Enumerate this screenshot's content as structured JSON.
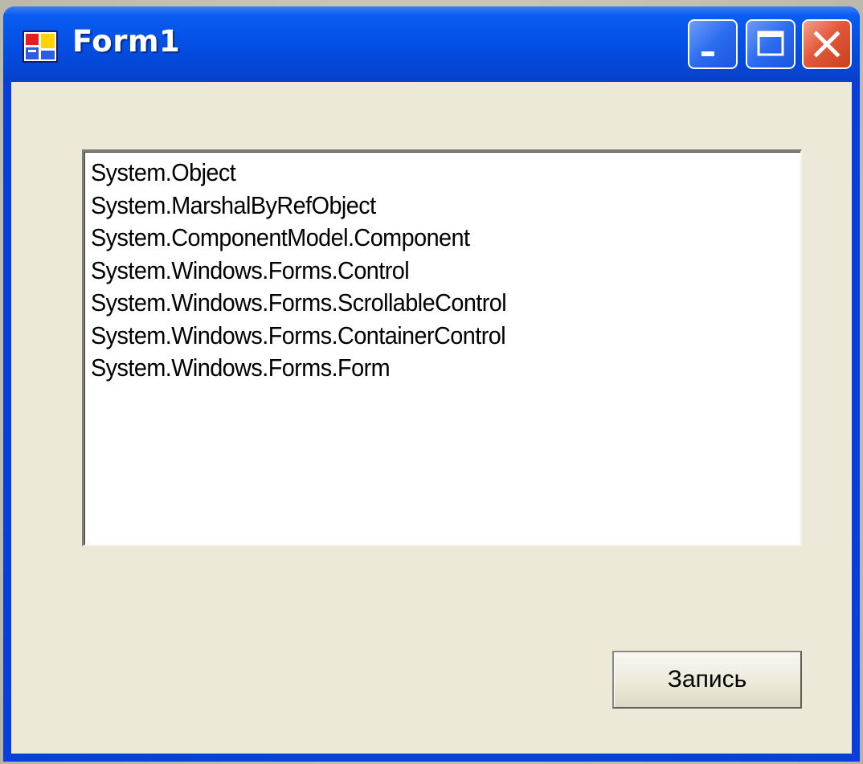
{
  "window": {
    "title": "Form1",
    "controls": {
      "minimize_icon": "minimize-icon",
      "maximize_icon": "maximize-icon",
      "close_icon": "close-icon"
    },
    "colors": {
      "titlebar": "#0551e6",
      "client": "#ece9d8",
      "close_button": "#e3583a"
    }
  },
  "listbox": {
    "items": [
      "System.Object",
      "System.MarshalByRefObject",
      "System.ComponentModel.Component",
      "System.Windows.Forms.Control",
      "System.Windows.Forms.ScrollableControl",
      "System.Windows.Forms.ContainerControl",
      "System.Windows.Forms.Form"
    ]
  },
  "button": {
    "label": "Запись"
  }
}
